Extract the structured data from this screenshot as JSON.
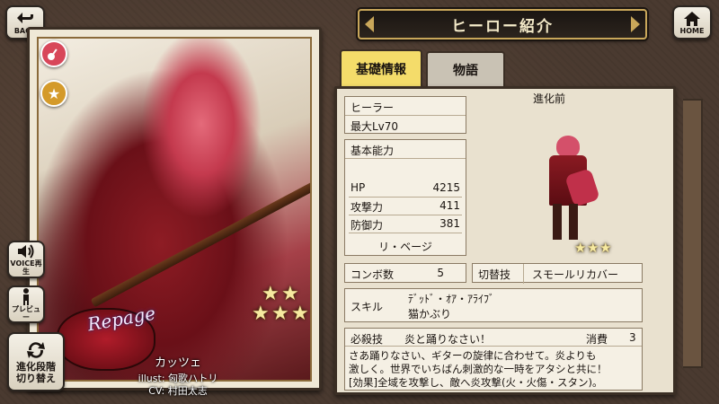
{
  "nav": {
    "back_label": "BACK",
    "home_label": "HOME"
  },
  "header": {
    "title": "ヒーロー紹介"
  },
  "tabs": [
    {
      "label": "基礎情報",
      "active": true
    },
    {
      "label": "物語",
      "active": false
    }
  ],
  "card": {
    "name": "カッツェ",
    "illust": "illust: 匈歌ハトリ",
    "cv": "CV: 村田太志",
    "logo_text": "Repage",
    "stars_top": [
      "★",
      "★"
    ],
    "stars_bottom": [
      "★",
      "★",
      "★"
    ],
    "class_icon": "guitar-icon",
    "rank_icon": "star-medal-icon"
  },
  "side_buttons": {
    "voice_label": "VOICE再生",
    "preview_label": "プレビュー",
    "evolution_line1": "進化段階",
    "evolution_line2": "切り替え"
  },
  "info": {
    "class": "ヒーラー",
    "max_level": "最大Lv70",
    "stats_header": "基本能力",
    "stats": [
      {
        "label": "HP",
        "value": "4215"
      },
      {
        "label": "攻撃力",
        "value": "411"
      },
      {
        "label": "防御力",
        "value": "381"
      }
    ],
    "leader": "リ・ベージ",
    "evolution_stage": "進化前",
    "sprite_stars": [
      "★",
      "★",
      "★"
    ],
    "combo_label": "コンボ数",
    "combo_value": "5",
    "switch_label": "切替技",
    "switch_value": "スモールリカバー",
    "skill_label": "スキル",
    "skill_line1": "ﾃﾞｯﾄﾞ・ｵｱ・ｱﾗｲﾌﾞ",
    "skill_line2": "猫かぶり",
    "special_label": "必殺技",
    "special_name": "炎と踊りなさい！",
    "cost_label": "消費",
    "cost_value": "3",
    "description_lines": [
      "さあ踊りなさい、ギターの旋律に合わせて。炎よりも",
      "激しく。世界でいちばん刺激的な一時をアタシと共に！",
      "[効果]全域を攻撃し、敵へ炎攻撃(火・火傷・スタン)。"
    ]
  },
  "colors": {
    "tab_active": "#f4dc6a",
    "tab_inactive": "#c9c2b4",
    "banner_gold": "#c9a75a",
    "panel_bg": "#e9e1cf",
    "guitar_icon_bg": "#d8475a",
    "medal_bg": "#d49a2a"
  }
}
